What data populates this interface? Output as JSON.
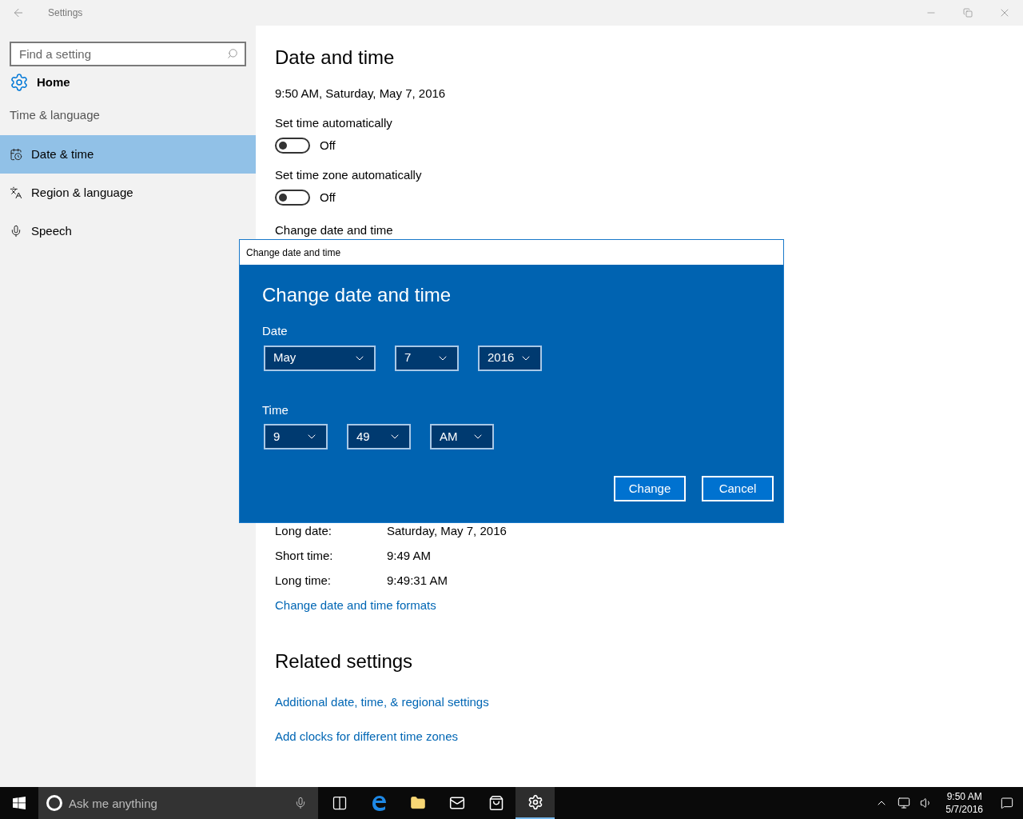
{
  "window": {
    "title": "Settings"
  },
  "sidebar": {
    "search": {
      "placeholder": "Find a setting"
    },
    "home": "Home",
    "section": "Time & language",
    "items": [
      {
        "label": "Date & time",
        "kind": "calendar",
        "selected": true
      },
      {
        "label": "Region & language",
        "kind": "language",
        "selected": false
      },
      {
        "label": "Speech",
        "kind": "mic",
        "selected": false
      }
    ]
  },
  "main": {
    "title": "Date and time",
    "current": "9:50 AM, Saturday, May 7, 2016",
    "toggles": [
      {
        "label": "Set time automatically",
        "on": false,
        "state": "Off"
      },
      {
        "label": "Set time zone automatically",
        "on": false,
        "state": "Off"
      }
    ],
    "change_label": "Change date and time",
    "formats": [
      {
        "label": "Long date:",
        "value": "Saturday, May 7, 2016"
      },
      {
        "label": "Short time:",
        "value": "9:49 AM"
      },
      {
        "label": "Long time:",
        "value": "9:49:31 AM"
      }
    ],
    "formats_link": "Change date and time formats",
    "related_title": "Related settings",
    "related_links": [
      "Additional date, time, & regional settings",
      "Add clocks for different time zones"
    ]
  },
  "dialog": {
    "title": "Change date and time",
    "heading": "Change date and time",
    "date_label": "Date",
    "date": [
      "May",
      "7",
      "2016"
    ],
    "time_label": "Time",
    "time": [
      "9",
      "49",
      "AM"
    ],
    "buttons": [
      "Change",
      "Cancel"
    ]
  },
  "taskbar": {
    "search_placeholder": "Ask me anything",
    "apps": [
      {
        "kind": "taskview",
        "active": false
      },
      {
        "kind": "edge",
        "active": false
      },
      {
        "kind": "explorer",
        "active": false
      },
      {
        "kind": "mail",
        "active": false
      },
      {
        "kind": "store",
        "active": false
      },
      {
        "kind": "settings",
        "active": true
      }
    ],
    "time": "9:50 AM",
    "date": "5/7/2016"
  }
}
